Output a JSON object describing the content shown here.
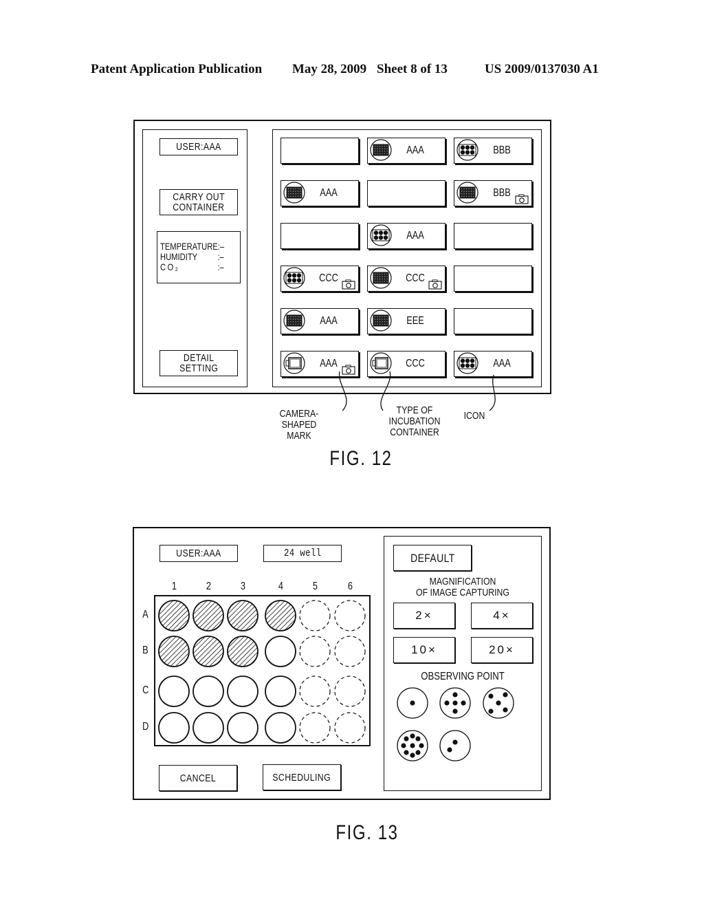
{
  "header": {
    "publication": "Patent Application Publication",
    "date": "May 28, 2009",
    "sheet": "Sheet 8 of 13",
    "number": "US 2009/0137030 A1"
  },
  "fig12": {
    "user_label": "USER:AAA",
    "carry_out_button": [
      "CARRY OUT",
      "CONTAINER"
    ],
    "environment": [
      {
        "key": "TEMPERATURE",
        "value": ":–"
      },
      {
        "key": "HUMIDITY",
        "value": ":–"
      },
      {
        "key": "CO₂",
        "value": ":–"
      }
    ],
    "detail_setting_button": [
      "DETAIL",
      "SETTING"
    ],
    "slots": [
      {
        "label": "",
        "icon": "none",
        "camera": false
      },
      {
        "label": "AAA",
        "icon": "96-well-plate",
        "camera": false
      },
      {
        "label": "BBB",
        "icon": "6-well-plate",
        "camera": false
      },
      {
        "label": "AAA",
        "icon": "96-well-plate",
        "camera": false
      },
      {
        "label": "",
        "icon": "none",
        "camera": false
      },
      {
        "label": "BBB",
        "icon": "96-well-plate",
        "camera": true
      },
      {
        "label": "",
        "icon": "none",
        "camera": false
      },
      {
        "label": "AAA",
        "icon": "6-well-plate",
        "camera": false
      },
      {
        "label": "",
        "icon": "none",
        "camera": false
      },
      {
        "label": "CCC",
        "icon": "6-well-plate",
        "camera": true
      },
      {
        "label": "CCC",
        "icon": "96-well-plate",
        "camera": true
      },
      {
        "label": "",
        "icon": "none",
        "camera": false
      },
      {
        "label": "AAA",
        "icon": "96-well-plate",
        "camera": false
      },
      {
        "label": "EEE",
        "icon": "96-well-plate",
        "camera": false
      },
      {
        "label": "",
        "icon": "none",
        "camera": false
      },
      {
        "label": "AAA",
        "icon": "flask",
        "camera": true
      },
      {
        "label": "CCC",
        "icon": "flask",
        "camera": false
      },
      {
        "label": "AAA",
        "icon": "6-well-plate",
        "camera": false
      }
    ],
    "callouts": {
      "camera_mark": [
        "CAMERA-SHAPED",
        "MARK"
      ],
      "container_type": [
        "TYPE OF",
        "INCUBATION",
        "CONTAINER"
      ],
      "icon": [
        "ICON"
      ]
    },
    "caption": "FIG. 12"
  },
  "fig13": {
    "user_label": "USER:AAA",
    "plate_type": "24 well",
    "columns": [
      "1",
      "2",
      "3",
      "4",
      "5",
      "6"
    ],
    "rows": [
      "A",
      "B",
      "C",
      "D"
    ],
    "wells": [
      [
        "selected",
        "selected",
        "selected",
        "selected",
        "disabled",
        "disabled"
      ],
      [
        "selected",
        "selected",
        "selected",
        "empty",
        "disabled",
        "disabled"
      ],
      [
        "empty",
        "empty",
        "empty",
        "empty",
        "disabled",
        "disabled"
      ],
      [
        "empty",
        "empty",
        "empty",
        "empty",
        "disabled",
        "disabled"
      ]
    ],
    "cancel_button": "CANCEL",
    "scheduling_button": "SCHEDULING",
    "default_button": "DEFAULT",
    "magnification_title": [
      "MAGNIFICATION",
      "OF IMAGE CAPTURING"
    ],
    "magnifications": [
      "2×",
      "4×",
      "10×",
      "20×"
    ],
    "observing_title": "OBSERVING POINT",
    "observing_points": [
      1,
      5,
      5,
      9,
      2
    ],
    "caption": "FIG. 13"
  }
}
